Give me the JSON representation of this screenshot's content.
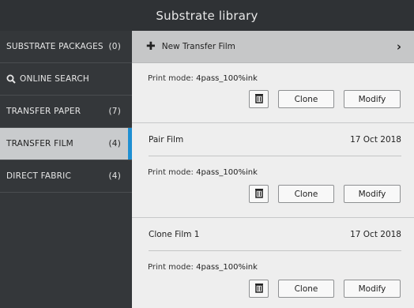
{
  "title": "Substrate library",
  "sidebar": {
    "items": [
      {
        "label": "SUBSTRATE PACKAGES",
        "count": "(0)"
      },
      {
        "label": "ONLINE SEARCH",
        "count": ""
      },
      {
        "label": "TRANSFER PAPER",
        "count": "(7)"
      },
      {
        "label": "TRANSFER FILM",
        "count": "(4)"
      },
      {
        "label": "DIRECT FABRIC",
        "count": "(4)"
      }
    ],
    "selected": "TRANSFER FILM",
    "accent_color": "#1f8fd2"
  },
  "new_button": {
    "label": "New Transfer Film",
    "icon": "plus-icon",
    "chevron": "›"
  },
  "cards": [
    {
      "name": "",
      "date": "",
      "print_mode_label": "Print mode:",
      "print_mode": "4pass_100%ink"
    },
    {
      "name": "Pair Film",
      "date": "17 Oct 2018",
      "print_mode_label": "Print mode:",
      "print_mode": "4pass_100%ink"
    },
    {
      "name": "Clone Film 1",
      "date": "17 Oct 2018",
      "print_mode_label": "Print mode:",
      "print_mode": "4pass_100%ink"
    }
  ],
  "actions": {
    "clone_label": "Clone",
    "modify_label": "Modify",
    "delete_icon": "trash-icon"
  }
}
